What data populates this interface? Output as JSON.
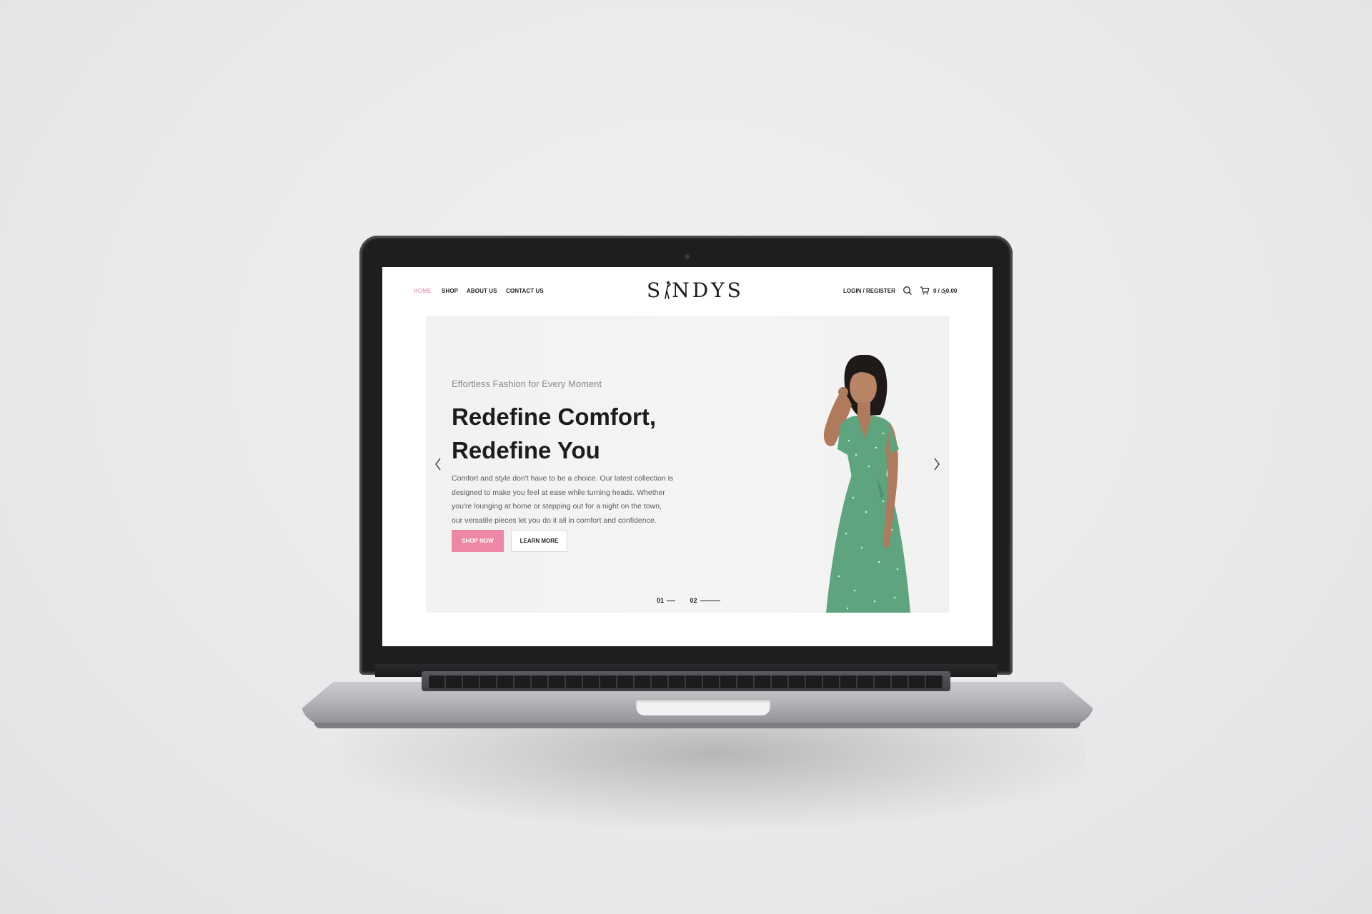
{
  "nav": {
    "items": [
      {
        "label": "HOME",
        "active": true
      },
      {
        "label": "SHOP",
        "active": false
      },
      {
        "label": "ABOUT US",
        "active": false
      },
      {
        "label": "CONTACT US",
        "active": false
      }
    ],
    "logo_left": "S",
    "logo_right": "NDYS",
    "login_label": "LOGIN / REGISTER",
    "cart_total": "0 / රු0.00",
    "icons": [
      "search-icon",
      "cart-icon"
    ]
  },
  "hero": {
    "eyebrow": "Effortless Fashion for Every Moment",
    "headline_line1": "Redefine Comfort,",
    "headline_line2": "Redefine You",
    "body_lines": [
      "Comfort and style don't have to be a choice. Our latest collection is",
      "designed to make you feel at ease while turning heads. Whether",
      "you're lounging at home or stepping out for a night on the town,",
      "our versatile pieces let you do it all in comfort and confidence."
    ],
    "primary_button": "SHOP NOW",
    "secondary_button": "LEARN MORE",
    "slides": [
      "01",
      "02"
    ],
    "active_slide": "01"
  },
  "colors": {
    "accent_pink": "#ee86a6",
    "nav_active": "#e8809e",
    "dress_green": "#5ea57f"
  }
}
